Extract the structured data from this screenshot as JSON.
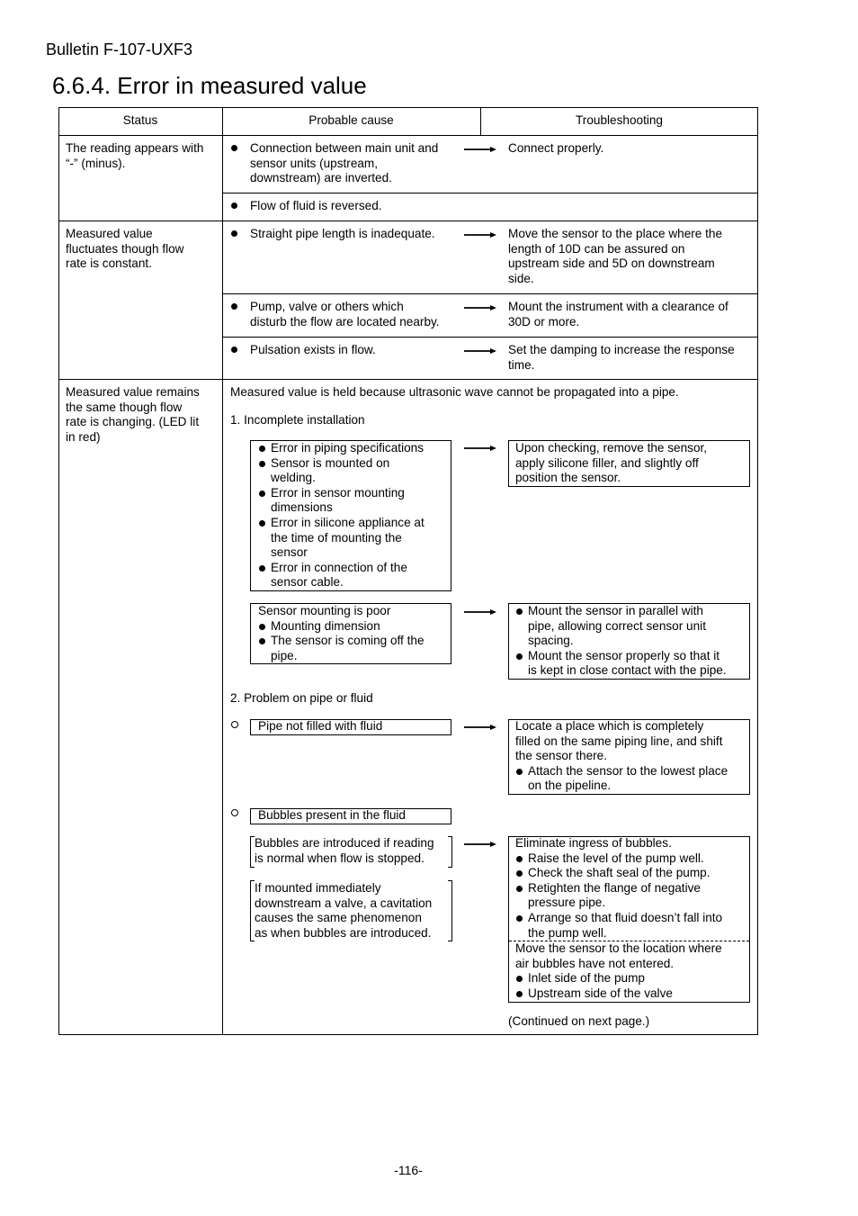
{
  "header": {
    "bulletin": "Bulletin F-107-UXF3",
    "title": "6.6.4. Error in measured value"
  },
  "table": {
    "columns": [
      "Status",
      "Probable cause",
      "Troubleshooting"
    ],
    "section1": {
      "status": [
        "The reading appears with",
        "“-” (minus)."
      ],
      "rows": [
        {
          "cause": [
            "Connection between main unit and",
            "sensor units (upstream,",
            "downstream) are inverted."
          ],
          "fix": [
            "Connect properly."
          ]
        },
        {
          "cause": [
            "Flow of fluid is reversed."
          ]
        }
      ]
    },
    "section2": {
      "status": [
        "Measured value",
        "fluctuates though flow",
        "rate is constant."
      ],
      "rows": [
        {
          "cause": [
            "Straight pipe length is inadequate."
          ],
          "fix": [
            "Move the sensor to the place where the",
            "length of 10D can be assured on",
            "upstream side and 5D on downstream",
            "side."
          ]
        },
        {
          "cause": [
            "Pump, valve or others which",
            "disturb the flow are located nearby."
          ],
          "fix": [
            "Mount the instrument with a clearance of",
            "30D or more."
          ]
        },
        {
          "cause": [
            "Pulsation exists in flow."
          ],
          "fix": [
            "Set the damping to increase the response",
            "time."
          ]
        }
      ]
    },
    "section3": {
      "status": [
        "Measured value remains",
        "the same though flow",
        "rate is changing. (LED lit",
        "in red)"
      ],
      "intro": "Measured value is held because ultrasonic wave cannot be propagated into a pipe.",
      "sub1": {
        "heading": "1. Incomplete installation",
        "group1": {
          "causes": [
            [
              "Error in piping specifications"
            ],
            [
              "Sensor is mounted on",
              "welding."
            ],
            [
              "Error in sensor mounting",
              "dimensions"
            ],
            [
              "Error in silicone appliance at",
              "the time of mounting the",
              "sensor"
            ],
            [
              "Error in connection of the",
              "sensor cable."
            ]
          ],
          "fix": [
            "Upon checking, remove the sensor,",
            "apply silicone filler, and slightly off",
            "position the sensor."
          ]
        },
        "group2": {
          "heading": "Sensor mounting is poor",
          "causes": [
            [
              "Mounting dimension"
            ],
            [
              "The sensor is coming off the",
              "pipe."
            ]
          ],
          "fixes": [
            [
              "Mount the sensor in parallel with",
              "pipe, allowing correct sensor unit",
              "spacing."
            ],
            [
              "Mount the sensor properly so that it",
              "is kept in close contact with the pipe."
            ]
          ]
        }
      },
      "sub2": {
        "heading": "2. Problem on pipe or fluid",
        "item1": {
          "cause": "Pipe not filled with fluid",
          "fix_intro": [
            "Locate a place which is completely",
            "filled on the same piping line, and shift",
            "the sensor there."
          ],
          "fix_bullets": [
            [
              "Attach the sensor to the lowest place",
              "on the pipeline."
            ]
          ]
        },
        "item2": {
          "cause": "Bubbles present in the fluid",
          "note1": [
            "Bubbles are introduced if reading",
            "is normal when flow is stopped."
          ],
          "note2": [
            "If mounted immediately",
            "downstream a valve, a cavitation",
            "causes the same phenomenon",
            "as when bubbles are introduced."
          ],
          "fix1_intro": "Eliminate ingress of bubbles.",
          "fix1_bullets": [
            [
              "Raise the level of the pump well."
            ],
            [
              "Check the shaft seal of the pump."
            ],
            [
              "Retighten the flange of negative",
              "pressure pipe."
            ],
            [
              "Arrange so that fluid doesn’t fall into",
              "the pump well."
            ]
          ],
          "fix2_intro": [
            "Move the sensor to the location where",
            "air bubbles have not entered."
          ],
          "fix2_bullets": [
            [
              "Inlet side of the pump"
            ],
            [
              "Upstream side of the valve"
            ]
          ]
        }
      },
      "continued": "(Continued on next page.)"
    }
  },
  "footer": {
    "page_number": "-116-"
  }
}
